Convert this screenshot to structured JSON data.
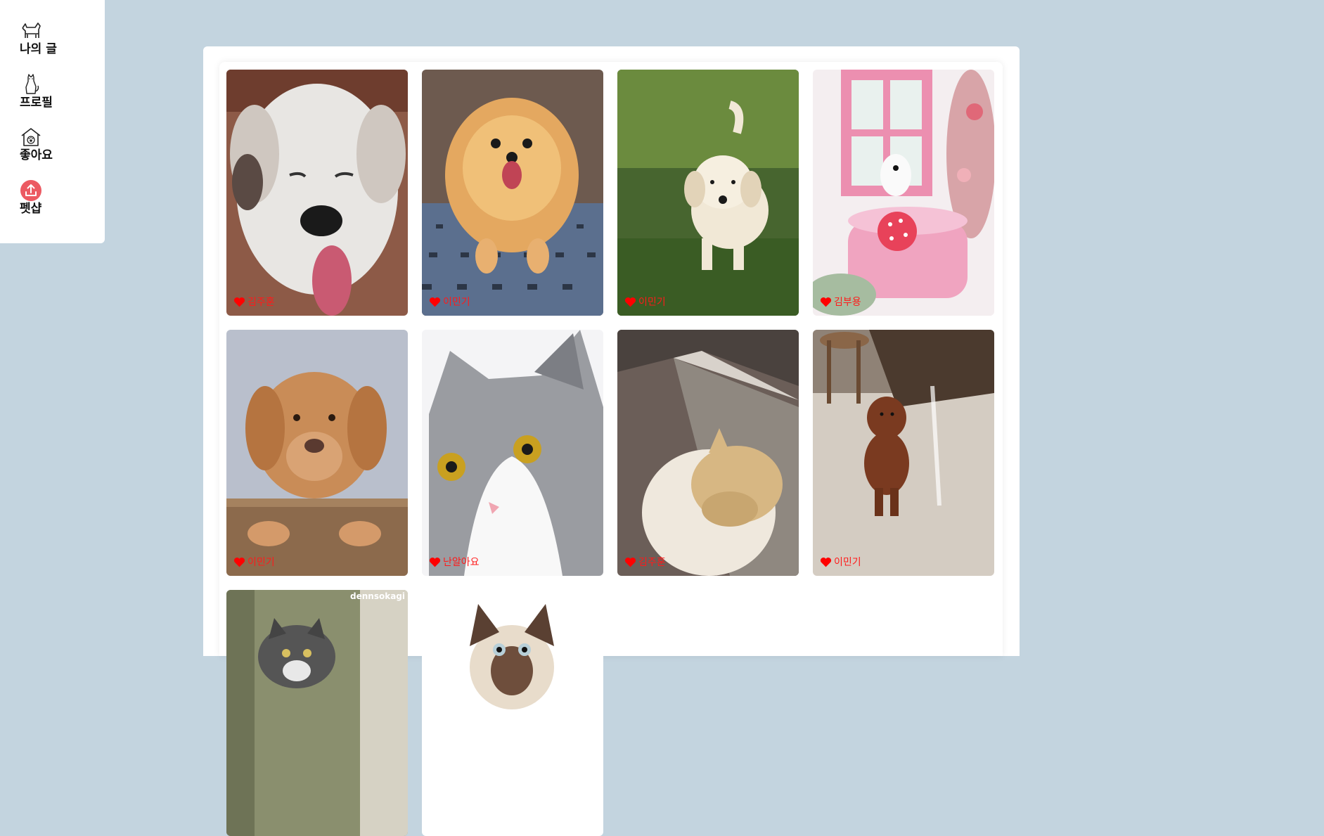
{
  "sidebar": {
    "items": [
      {
        "label": "나의 글",
        "icon": "dog-outline-icon"
      },
      {
        "label": "프로필",
        "icon": "cat-sitting-icon"
      },
      {
        "label": "좋아요",
        "icon": "pet-house-icon"
      },
      {
        "label": "펫샵",
        "icon": "upload-circle-icon"
      }
    ]
  },
  "gallery": {
    "posts": [
      {
        "author": "김주훈",
        "icon": "heart-icon",
        "subject": "white puppy close-up"
      },
      {
        "author": "이민기",
        "icon": "heart-icon",
        "subject": "pomeranian"
      },
      {
        "author": "이민기",
        "icon": "heart-icon",
        "subject": "puppy walking on grass"
      },
      {
        "author": "김부용",
        "icon": "heart-icon",
        "subject": "white dog on pink cake"
      },
      {
        "author": "이민기",
        "icon": "heart-icon",
        "subject": "brown puppy on fence"
      },
      {
        "author": "난알아요",
        "icon": "heart-icon",
        "subject": "grey and white cat"
      },
      {
        "author": "김주훈",
        "icon": "heart-icon",
        "subject": "cream cat"
      },
      {
        "author": "이민기",
        "icon": "heart-icon",
        "subject": "brown poodle"
      },
      {
        "author": "",
        "icon": "heart-icon",
        "subject": "kittens"
      },
      {
        "author": "",
        "icon": "heart-icon",
        "subject": "siamese cat"
      }
    ],
    "watermark": "dennsokagi"
  },
  "colors": {
    "background": "#c3d4df",
    "panel": "#ffffff",
    "like_text": "#ff1a1a",
    "upload_accent": "#ec5a62"
  }
}
